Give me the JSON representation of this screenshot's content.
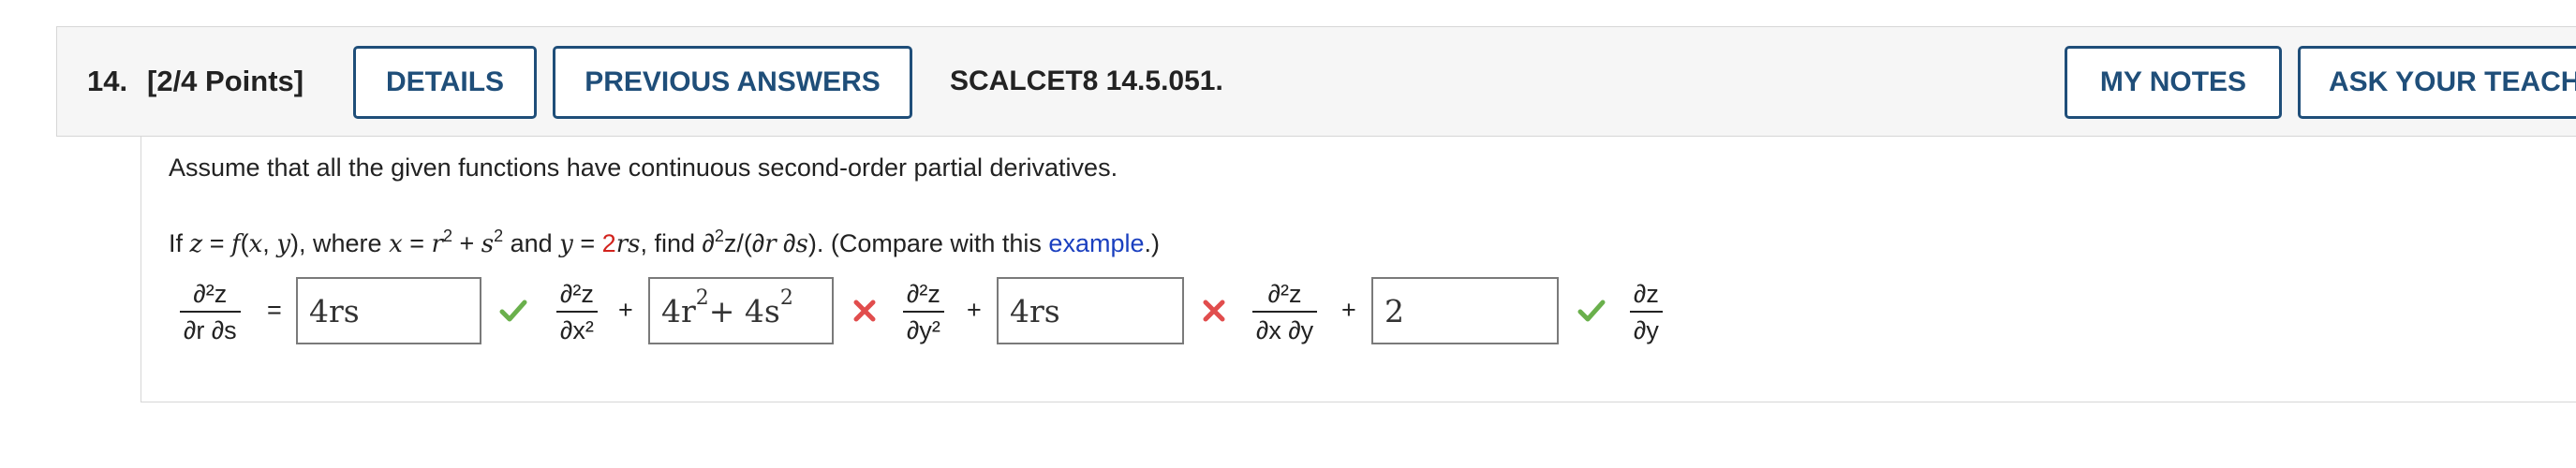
{
  "header": {
    "question_number": "14.",
    "points": "[2/4 Points]",
    "details_label": "DETAILS",
    "previous_answers_label": "PREVIOUS ANSWERS",
    "reference": "SCALCET8 14.5.051.",
    "my_notes_label": "MY NOTES",
    "ask_teacher_label": "ASK YOUR TEACH"
  },
  "problem": {
    "instruction": "Assume that all the given functions have continuous second-order partial derivatives.",
    "if": "If ",
    "z": "z",
    "eq1": " = ",
    "f": "f",
    "open": "(",
    "x1": "x",
    "comma": ", ",
    "y1": "y",
    "close": ")",
    "where": ", where ",
    "x2": "x",
    "eq2": " = ",
    "r1": "r",
    "sq1": "2",
    "plus": " + ",
    "s1": "s",
    "sq2": "2",
    "and": " and ",
    "y2": "y",
    "eq3": " = ",
    "two": "2",
    "rs": "rs",
    "find": ", find ∂",
    "sq3": "2",
    "zslash": "z/(∂",
    "r2": "r",
    "d": " ∂",
    "s2": "s",
    "tail": ").  (Compare with this ",
    "example_link": "example",
    "end": ".)"
  },
  "equation": {
    "lhs_num": "∂²z",
    "lhs_den": "∂r ∂s",
    "equals": "=",
    "t1_num": "∂²z",
    "t1_den": "∂x²",
    "plus1": "+",
    "t2_num": "∂²z",
    "t2_den": "∂y²",
    "plus2": "+",
    "t3_num": "∂²z",
    "t3_den": "∂x ∂y",
    "plus3": "+",
    "t4_num": "∂z",
    "t4_den": "∂y",
    "answers": {
      "a1": "4rs",
      "a2_part1": "4r",
      "a2_exp1": "2",
      "a2_part2": " + 4s",
      "a2_exp2": "2",
      "a3": "4rs",
      "a4": "2"
    },
    "status": [
      "correct",
      "incorrect",
      "incorrect",
      "correct"
    ]
  },
  "colors": {
    "brand_blue": "#1f4e79",
    "correct_green": "#6ab04c",
    "incorrect_red": "#e14d4d",
    "link_blue": "#1a3fbf"
  }
}
